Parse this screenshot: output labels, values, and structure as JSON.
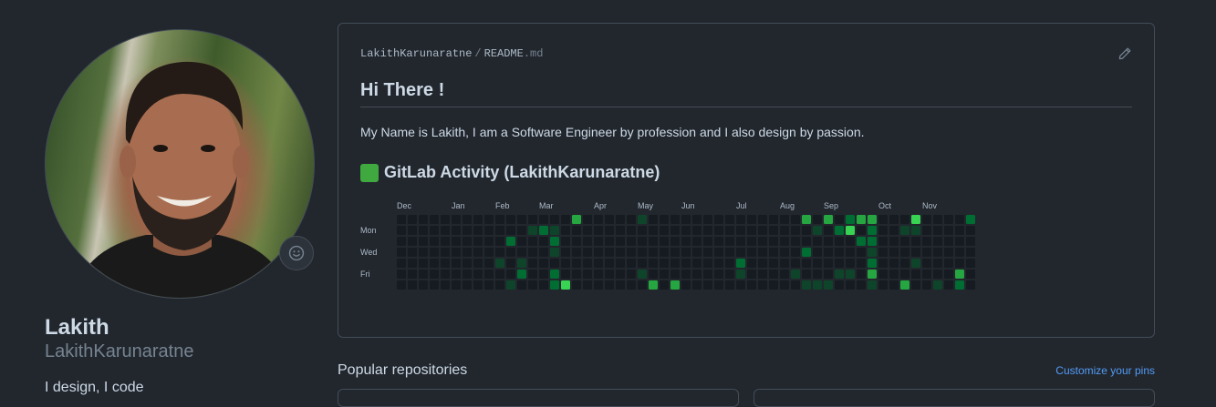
{
  "profile": {
    "display_name": "Lakith",
    "username": "LakithKarunaratne",
    "bio": "I design, I code",
    "status_icon": "smiley-icon"
  },
  "readme": {
    "path_owner": "LakithKarunaratne",
    "path_separator": "/",
    "path_file": "README",
    "path_ext": ".md",
    "edit_icon": "pencil-icon",
    "heading": "Hi There !",
    "intro": "My Name is Lakith, I am a Software Engineer by profession and I also design by passion.",
    "activity_heading": "GitLab Activity (LakithKarunaratne)",
    "activity_icon": "green-square-icon"
  },
  "activity": {
    "months": [
      "Dec",
      "Jan",
      "Feb",
      "Mar",
      "Apr",
      "May",
      "Jun",
      "Jul",
      "Aug",
      "Sep",
      "Oct",
      "Nov"
    ],
    "month_weeks": [
      0,
      5,
      9,
      13,
      18,
      22,
      26,
      31,
      35,
      39,
      44,
      48
    ],
    "day_labels": [
      "Mon",
      "Wed",
      "Fri"
    ],
    "week_count": 53,
    "colors": [
      "#161b22",
      "#0e4429",
      "#006d32",
      "#26a641",
      "#39d353"
    ],
    "cells": [
      [
        16,
        0,
        3
      ],
      [
        22,
        0,
        1
      ],
      [
        37,
        0,
        3
      ],
      [
        39,
        0,
        3
      ],
      [
        41,
        0,
        2
      ],
      [
        42,
        0,
        3
      ],
      [
        43,
        0,
        3
      ],
      [
        47,
        0,
        4
      ],
      [
        52,
        0,
        2
      ],
      [
        12,
        1,
        1
      ],
      [
        13,
        1,
        2
      ],
      [
        14,
        1,
        1
      ],
      [
        38,
        1,
        1
      ],
      [
        40,
        1,
        2
      ],
      [
        41,
        1,
        4
      ],
      [
        43,
        1,
        2
      ],
      [
        46,
        1,
        1
      ],
      [
        47,
        1,
        1
      ],
      [
        10,
        2,
        2
      ],
      [
        14,
        2,
        2
      ],
      [
        42,
        2,
        2
      ],
      [
        43,
        2,
        2
      ],
      [
        14,
        3,
        1
      ],
      [
        37,
        3,
        2
      ],
      [
        43,
        3,
        1
      ],
      [
        9,
        4,
        1
      ],
      [
        11,
        4,
        1
      ],
      [
        31,
        4,
        2
      ],
      [
        43,
        4,
        2
      ],
      [
        47,
        4,
        1
      ],
      [
        11,
        5,
        2
      ],
      [
        14,
        5,
        2
      ],
      [
        22,
        5,
        1
      ],
      [
        31,
        5,
        1
      ],
      [
        36,
        5,
        1
      ],
      [
        40,
        5,
        1
      ],
      [
        41,
        5,
        1
      ],
      [
        43,
        5,
        3
      ],
      [
        51,
        5,
        3
      ],
      [
        10,
        6,
        1
      ],
      [
        14,
        6,
        2
      ],
      [
        15,
        6,
        4
      ],
      [
        23,
        6,
        3
      ],
      [
        25,
        6,
        3
      ],
      [
        37,
        6,
        1
      ],
      [
        38,
        6,
        1
      ],
      [
        39,
        6,
        1
      ],
      [
        43,
        6,
        1
      ],
      [
        46,
        6,
        3
      ],
      [
        49,
        6,
        1
      ],
      [
        51,
        6,
        2
      ]
    ]
  }
}
